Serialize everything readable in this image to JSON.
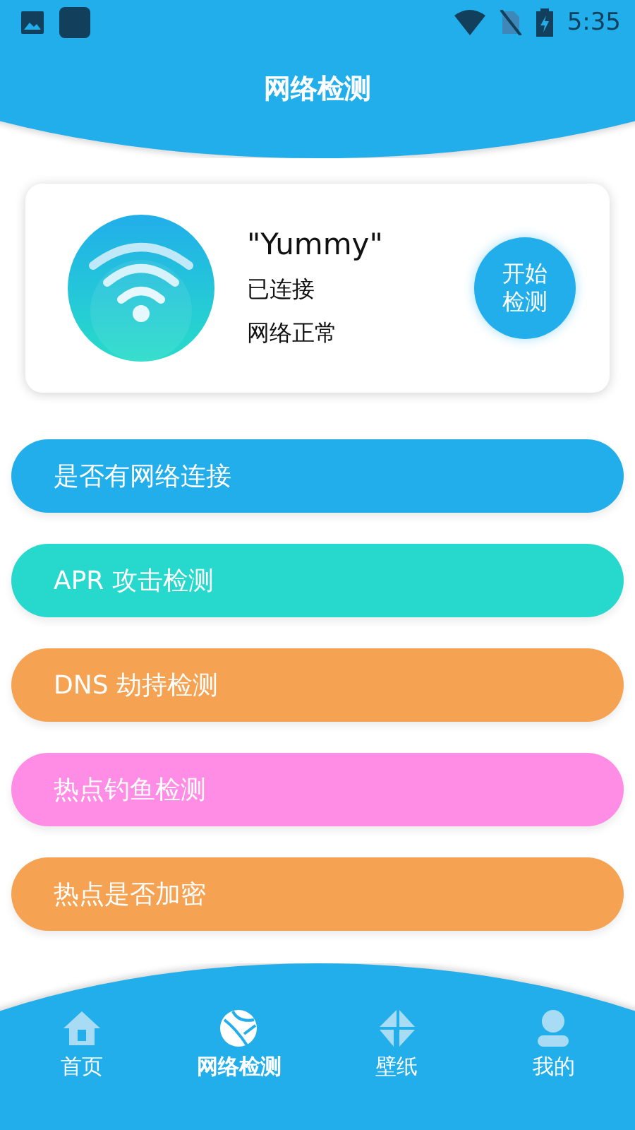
{
  "status_bar": {
    "time": "5:35"
  },
  "header": {
    "title": "网络检测"
  },
  "network_card": {
    "ssid": "\"Yummy\"",
    "connection": "已连接",
    "status": "网络正常",
    "button": "开始检测"
  },
  "checks": [
    {
      "label": "是否有网络连接",
      "color": "#22aeea"
    },
    {
      "label": "APR 攻击检测",
      "color": "#27d8cc"
    },
    {
      "label": "DNS 劫持检测",
      "color": "#f5a352"
    },
    {
      "label": "热点钓鱼检测",
      "color": "#ff8de6"
    },
    {
      "label": "热点是否加密",
      "color": "#f5a352"
    }
  ],
  "bottom_nav": [
    {
      "label": "首页",
      "kind": "home",
      "selected": false
    },
    {
      "label": "网络检测",
      "kind": "network",
      "selected": true
    },
    {
      "label": "壁纸",
      "kind": "wallpaper",
      "selected": false
    },
    {
      "label": "我的",
      "kind": "profile",
      "selected": false
    }
  ]
}
